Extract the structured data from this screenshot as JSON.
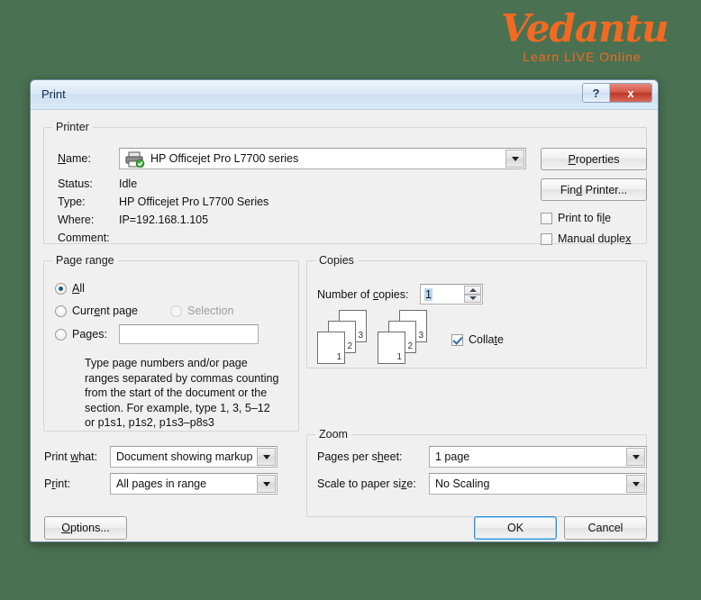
{
  "logo": {
    "word": "Vedantu",
    "tagline": "Learn LIVE Online",
    "color": "#f26a21"
  },
  "background_color": "#4a7152",
  "dialog": {
    "title": "Print",
    "titlebar_buttons": [
      {
        "name": "help-button",
        "glyph": "?"
      },
      {
        "name": "close-button",
        "glyph": "x"
      }
    ]
  },
  "printer": {
    "legend": "Printer",
    "name_label": "Name:",
    "name_value": "HP Officejet Pro L7700 series",
    "name_icon": "printer-ready-icon",
    "status_label": "Status:",
    "status_value": "Idle",
    "type_label": "Type:",
    "type_value": "HP Officejet Pro L7700 Series",
    "where_label": "Where:",
    "where_value": "IP=192.168.1.105",
    "comment_label": "Comment:",
    "comment_value": "",
    "properties_button": "Properties",
    "find_printer_button": "Find Printer...",
    "print_to_file": {
      "label": "Print to file",
      "checked": false
    },
    "manual_duplex": {
      "label": "Manual duplex",
      "checked": false
    }
  },
  "page_range": {
    "legend": "Page range",
    "options": [
      {
        "label": "All",
        "selected": true,
        "disabled": false
      },
      {
        "label": "Current page",
        "selected": false,
        "disabled": false
      },
      {
        "label": "Selection",
        "selected": false,
        "disabled": true
      },
      {
        "label": "Pages:",
        "selected": false,
        "disabled": false
      }
    ],
    "pages_value": "",
    "help": "Type page numbers and/or page ranges separated by commas counting from the start of the document or the section. For example, type 1, 3, 5–12 or p1s1, p1s2, p1s3–p8s3"
  },
  "copies": {
    "legend": "Copies",
    "number_label": "Number of copies:",
    "number_value": "1",
    "collate": {
      "label": "Collate",
      "checked": true
    },
    "stack_page_numbers": [
      "3",
      "2",
      "1"
    ]
  },
  "print_options": {
    "print_what_label": "Print what:",
    "print_what_value": "Document showing markup",
    "print_label": "Print:",
    "print_value": "All pages in range"
  },
  "zoom": {
    "legend": "Zoom",
    "pages_per_sheet_label": "Pages per sheet:",
    "pages_per_sheet_value": "1 page",
    "scale_label": "Scale to paper size:",
    "scale_value": "No Scaling"
  },
  "footer": {
    "options_button": "Options...",
    "ok_button": "OK",
    "cancel_button": "Cancel"
  }
}
